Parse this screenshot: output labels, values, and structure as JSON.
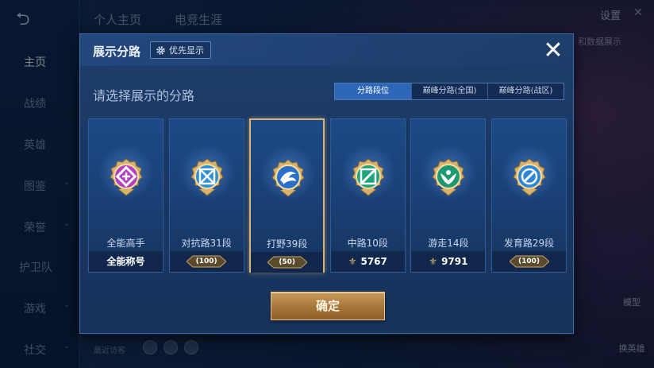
{
  "background": {
    "top_tabs": [
      "个人主页",
      "电竞生涯"
    ],
    "settings_label": "设置",
    "corner_text": "和数据展示",
    "sidebar_items": [
      {
        "label": "主页",
        "active": true
      },
      {
        "label": "战绩",
        "active": false
      },
      {
        "label": "英雄",
        "active": false
      },
      {
        "label": "图鉴",
        "active": false
      },
      {
        "label": "荣誉",
        "active": false
      },
      {
        "label": "护卫队",
        "active": false
      },
      {
        "label": "游戏",
        "active": false
      },
      {
        "label": "社交",
        "active": false
      }
    ],
    "recent_visitors_label": "最近访客",
    "model_button": "模型",
    "change_hero_button": "换英雄"
  },
  "modal": {
    "title": "展示分路",
    "priority_button": "优先显示",
    "subtitle": "请选择展示的分路",
    "tabs": [
      {
        "label": "分路段位",
        "active": true
      },
      {
        "label": "巅峰分路(全国)",
        "active": false
      },
      {
        "label": "巅峰分路(战区)",
        "active": false
      }
    ],
    "cards": [
      {
        "label": "全能高手",
        "footer_text": "全能称号",
        "footer_type": "text",
        "badge_color": "#b23fc4",
        "badge_icon": "all-round-icon",
        "selected": false
      },
      {
        "label": "对抗路31段",
        "footer_text": "100",
        "footer_type": "tag",
        "badge_color": "#2b8fd9",
        "badge_icon": "clash-lane-icon",
        "selected": false
      },
      {
        "label": "打野39段",
        "footer_text": "50",
        "footer_type": "tag",
        "badge_color": "#2a6fc8",
        "badge_icon": "jungle-dragon-icon",
        "selected": true
      },
      {
        "label": "中路10段",
        "footer_text": "5767",
        "footer_type": "score",
        "badge_color": "#1fa37a",
        "badge_icon": "mid-lane-icon",
        "selected": false
      },
      {
        "label": "游走14段",
        "footer_text": "9791",
        "footer_type": "score",
        "badge_color": "#1e9a72",
        "badge_icon": "roam-icon",
        "selected": false
      },
      {
        "label": "发育路29段",
        "footer_text": "100",
        "footer_type": "tag",
        "badge_color": "#2a86d6",
        "badge_icon": "farm-lane-icon",
        "selected": false
      }
    ],
    "confirm_button": "确定"
  },
  "colors": {
    "accent_blue": "#2f67b8",
    "gold": "#d7b37a",
    "modal_bg": "#1a3864"
  }
}
